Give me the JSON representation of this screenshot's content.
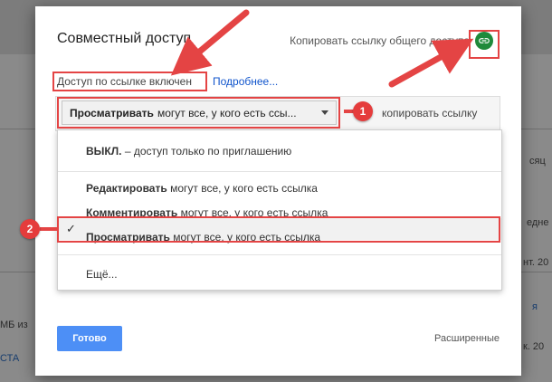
{
  "background": {
    "fragments": [
      "сяц",
      "едне",
      "нт. 20",
      "я",
      "МБ из",
      "СТА",
      "к. 20"
    ]
  },
  "dialog": {
    "title": "Совместный доступ",
    "copy_public_link_label": "Копировать ссылку общего доступа",
    "link_icon": "link-icon",
    "access_status": "Доступ по ссылке включен",
    "more_link": "Подробнее...",
    "access_select": {
      "bold": "Просматривать",
      "rest": "могут все, у кого есть ссы...",
      "caret_icon": "caret-down-icon"
    },
    "copy_link_label": "копировать ссылку",
    "menu": {
      "off_bold": "ВЫКЛ.",
      "off_rest": "– доступ только по приглашению",
      "edit_bold": "Редактировать",
      "edit_rest": "могут все, у кого есть ссылка",
      "comment_bold": "Комментировать",
      "comment_rest": "могут все, у кого есть ссылка",
      "view_bold": "Просматривать",
      "view_rest": "могут все, у кого есть ссылка",
      "more": "Ещё..."
    },
    "done_label": "Готово",
    "advanced_label": "Расширенные"
  },
  "annotations": {
    "badge_1": "1",
    "badge_2": "2",
    "color": "#e44444"
  }
}
